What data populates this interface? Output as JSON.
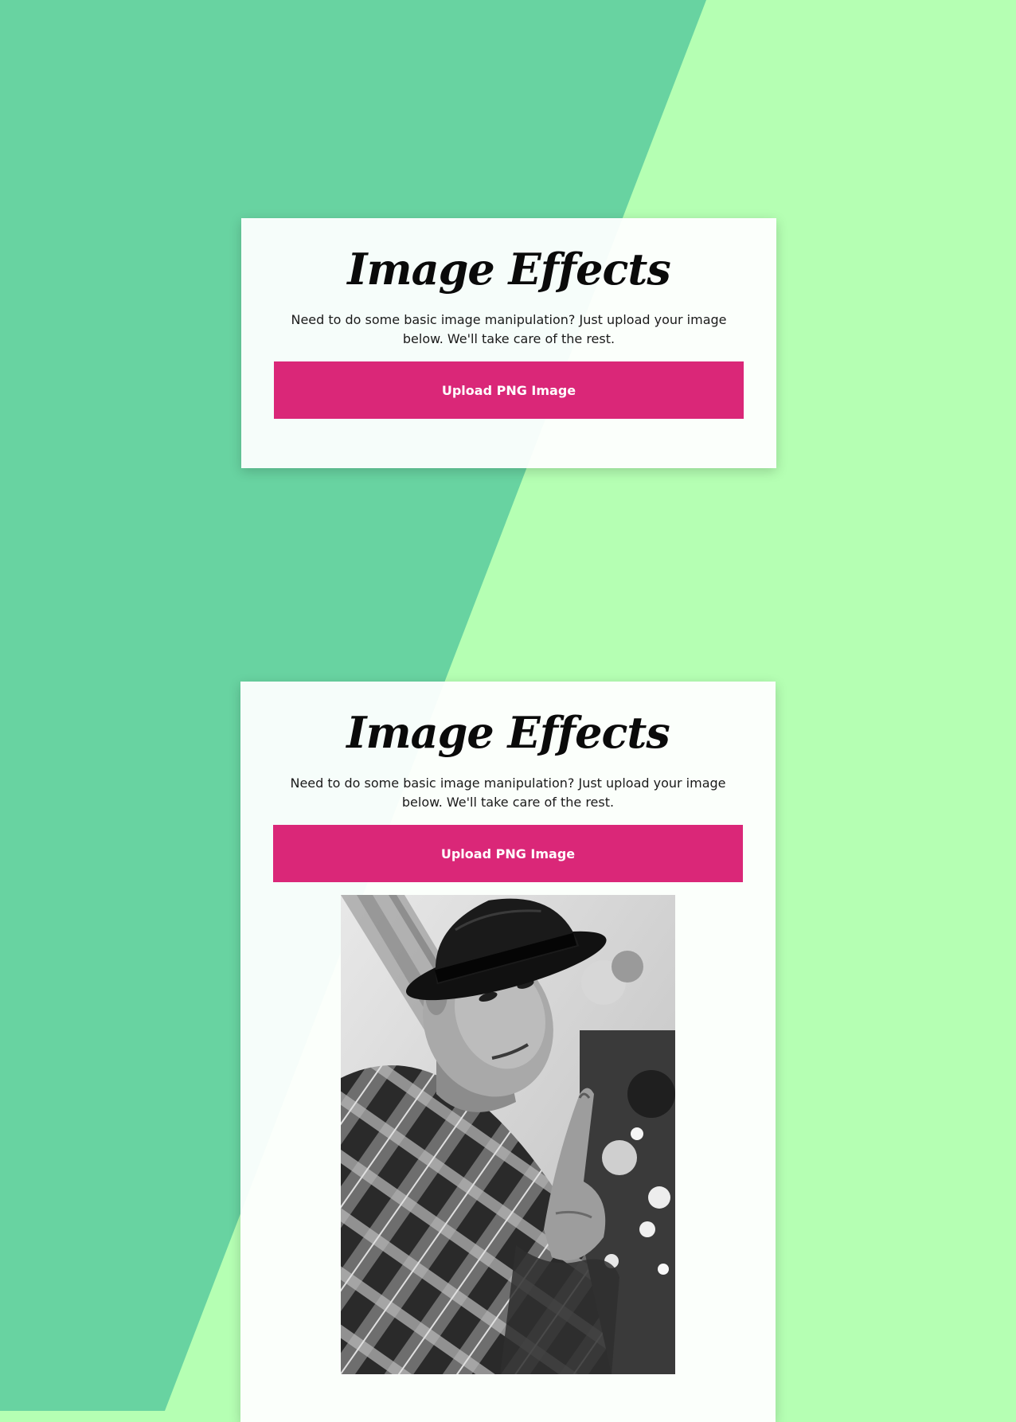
{
  "colors": {
    "background_light": "#b5ffb3",
    "background_dark": "#68d3a1",
    "card": "#ffffff",
    "accent": "#da2778"
  },
  "panels": [
    {
      "title": "Image Effects",
      "description": "Need to do some basic image manipulation? Just upload your image below. We'll take care of the rest.",
      "upload_label": "Upload PNG Image"
    },
    {
      "title": "Image Effects",
      "description": "Need to do some basic image manipulation? Just upload your image below. We'll take care of the rest.",
      "upload_label": "Upload PNG Image",
      "preview_image": "grayscale-portrait-man-in-hat"
    }
  ]
}
